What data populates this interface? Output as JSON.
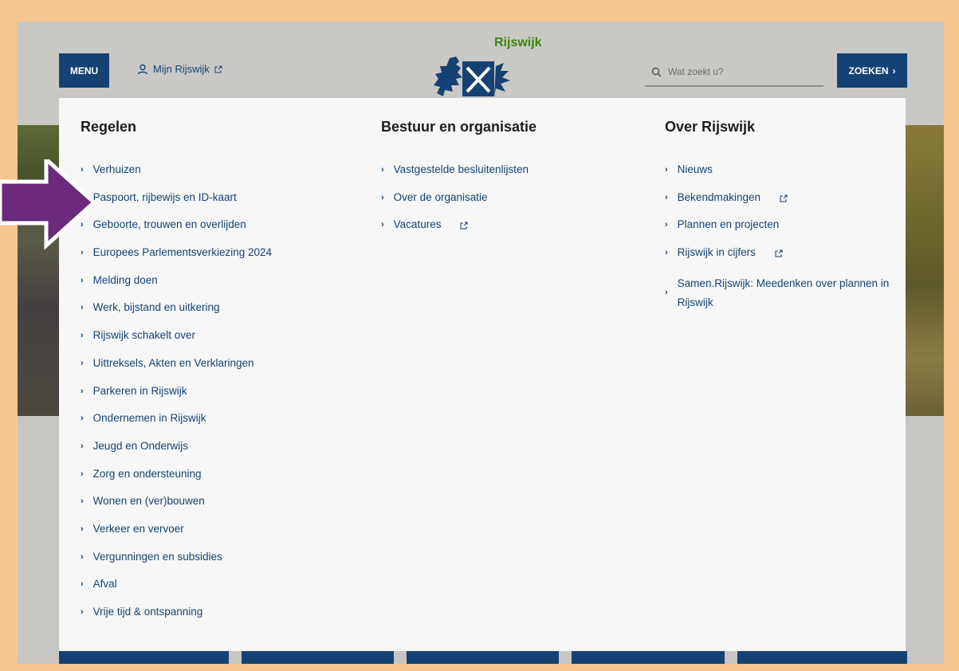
{
  "header": {
    "menu_label": "MENU",
    "mijn_label": "Mijn Rijswijk",
    "logo_text": "Rijswijk",
    "search_placeholder": "Wat zoekt u?",
    "zoeken_label": "ZOEKEN"
  },
  "columns": [
    {
      "title": "Regelen",
      "items": [
        {
          "label": "Verhuizen",
          "external": false
        },
        {
          "label": "Paspoort, rijbewijs en ID-kaart",
          "external": false
        },
        {
          "label": "Geboorte, trouwen en overlijden",
          "external": false
        },
        {
          "label": "Europees Parlementsverkiezing 2024",
          "external": false
        },
        {
          "label": "Melding doen",
          "external": false
        },
        {
          "label": "Werk, bijstand en uitkering",
          "external": false
        },
        {
          "label": "Rijswijk schakelt over",
          "external": false
        },
        {
          "label": "Uittreksels, Akten en Verklaringen",
          "external": false
        },
        {
          "label": "Parkeren in Rijswijk",
          "external": false
        },
        {
          "label": "Ondernemen in Rijswijk",
          "external": false
        },
        {
          "label": "Jeugd en Onderwijs",
          "external": false
        },
        {
          "label": "Zorg en ondersteuning",
          "external": false
        },
        {
          "label": "Wonen en (ver)bouwen",
          "external": false
        },
        {
          "label": "Verkeer en vervoer",
          "external": false
        },
        {
          "label": "Vergunningen en subsidies",
          "external": false
        },
        {
          "label": "Afval",
          "external": false
        },
        {
          "label": "Vrije tijd & ontspanning",
          "external": false
        }
      ]
    },
    {
      "title": "Bestuur en organisatie",
      "items": [
        {
          "label": "Vastgestelde besluitenlijsten",
          "external": false
        },
        {
          "label": "Over de organisatie",
          "external": false
        },
        {
          "label": "Vacatures",
          "external": true
        }
      ]
    },
    {
      "title": "Over Rijswijk",
      "items": [
        {
          "label": "Nieuws",
          "external": false
        },
        {
          "label": "Bekendmakingen",
          "external": true
        },
        {
          "label": "Plannen en projecten",
          "external": false
        },
        {
          "label": "Rijswijk in cijfers",
          "external": true
        },
        {
          "label": "Samen.Rijswijk: Meedenken over plannen in Rijswijk",
          "external": false
        }
      ]
    }
  ],
  "colors": {
    "primary_blue": "#154273",
    "logo_green": "#39870c",
    "annotation_arrow": "#6b2a7b",
    "frame": "#f6c690"
  },
  "icons": {
    "mijn": "user-icon",
    "external": "external-link-icon",
    "search": "search-icon",
    "chevron": "chevron-right-icon"
  }
}
